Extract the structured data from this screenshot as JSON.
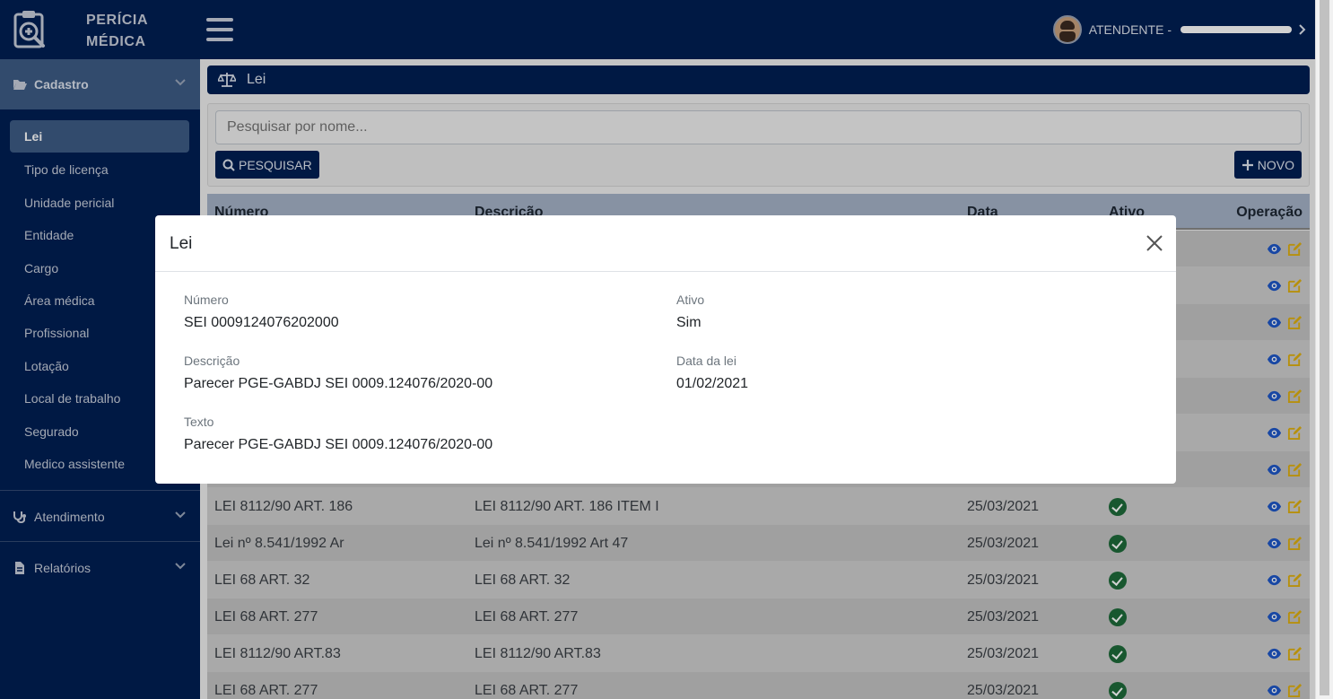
{
  "brand": {
    "line1": "PERÍCIA",
    "line2": "MÉDICA"
  },
  "user": {
    "label": "ATENDENTE -"
  },
  "sidebar": {
    "sections": [
      {
        "label": "Cadastro",
        "icon": "folder-open-icon"
      },
      {
        "label": "Atendimento",
        "icon": "stethoscope-icon"
      },
      {
        "label": "Relatórios",
        "icon": "file-icon"
      }
    ],
    "items": [
      {
        "label": "Lei"
      },
      {
        "label": "Tipo de licença"
      },
      {
        "label": "Unidade pericial"
      },
      {
        "label": "Entidade"
      },
      {
        "label": "Cargo"
      },
      {
        "label": "Área médica"
      },
      {
        "label": "Profissional"
      },
      {
        "label": "Lotação"
      },
      {
        "label": "Local de trabalho"
      },
      {
        "label": "Segurado"
      },
      {
        "label": "Medico assistente"
      }
    ]
  },
  "page": {
    "title": "Lei"
  },
  "search": {
    "placeholder": "Pesquisar por nome...",
    "button": "PESQUISAR",
    "new_button": "NOVO"
  },
  "table": {
    "headers": {
      "numero": "Número",
      "descricao": "Descrição",
      "data": "Data",
      "ativo": "Ativo",
      "operacao": "Operação"
    },
    "rows": [
      {
        "numero": "LEI 8112/90 ART. 186",
        "descricao": "LEI 8112/90 ART. 186 ITEM I",
        "data": "25/03/2021"
      },
      {
        "numero": "Lei nº 8.541/1992 Ar",
        "descricao": "Lei nº 8.541/1992 Art 47",
        "data": "25/03/2021"
      },
      {
        "numero": "LEI 68 ART. 32",
        "descricao": "LEI 68 ART. 32",
        "data": "25/03/2021"
      },
      {
        "numero": "LEI 68 ART. 277",
        "descricao": "LEI 68 ART. 277",
        "data": "25/03/2021"
      },
      {
        "numero": "LEI 8112/90 ART.83",
        "descricao": "LEI 8112/90 ART.83",
        "data": "25/03/2021"
      },
      {
        "numero": "LEI 68 ART. 277",
        "descricao": "LEI 68 ART. 277",
        "data": "25/03/2021"
      }
    ]
  },
  "modal": {
    "title": "Lei",
    "numero_label": "Número",
    "numero_value": "SEI 0009124076202000",
    "ativo_label": "Ativo",
    "ativo_value": "Sim",
    "descricao_label": "Descrição",
    "descricao_value": "Parecer PGE-GABDJ SEI 0009.124076/2020-00",
    "data_label": "Data da lei",
    "data_value": "01/02/2021",
    "texto_label": "Texto",
    "texto_value": "Parecer PGE-GABDJ SEI 0009.124076/2020-00"
  },
  "colors": {
    "primary": "#001f54",
    "sidebar_active": "#3e5c86",
    "check": "#1e6b3a",
    "eye": "#1e57c8",
    "edit": "#e0b010"
  }
}
